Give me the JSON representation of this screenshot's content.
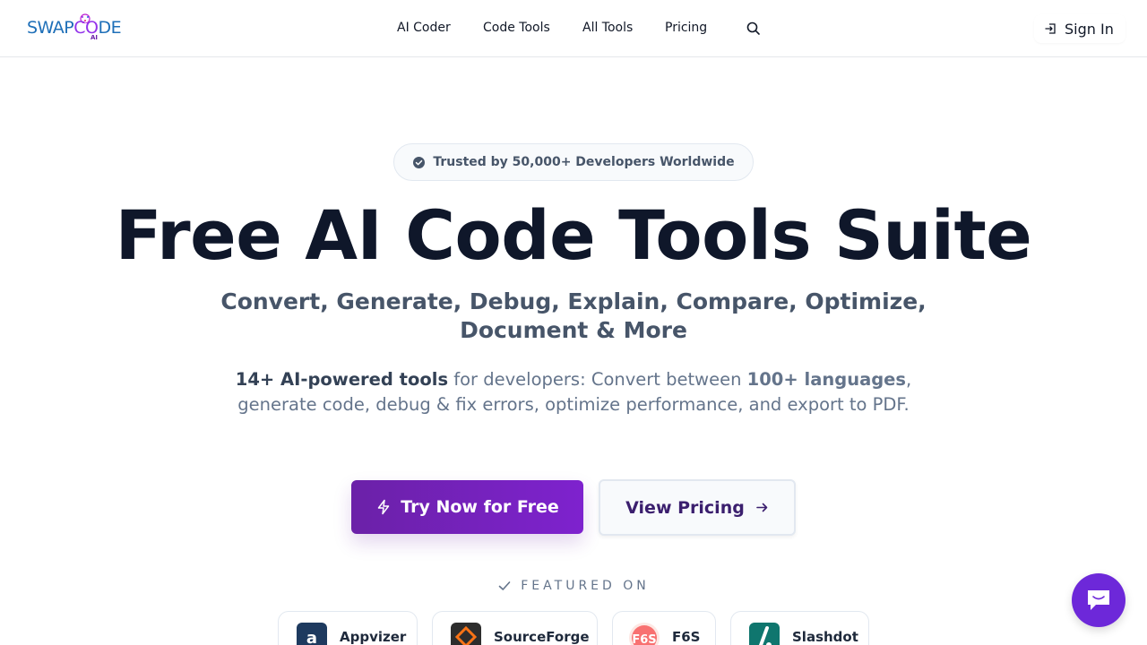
{
  "header": {
    "logo_text_a": "SWAP",
    "logo_text_b": "C",
    "logo_text_c": "DE",
    "logo_sub": "AI",
    "nav": [
      "AI Coder",
      "Code Tools",
      "All Tools",
      "Pricing"
    ],
    "search_icon": "search-icon",
    "signin_label": "Sign In"
  },
  "hero": {
    "badge": "Trusted by 50,000+ Developers Worldwide",
    "title": "Free AI Code Tools Suite",
    "subtitle": "Convert, Generate, Debug, Explain, Compare, Optimize, Document & More",
    "desc_part1": "14+ AI-powered tools",
    "desc_part2": " for developers: Convert between ",
    "desc_part3": "100+ languages",
    "desc_part4": ", generate code, debug & fix errors, optimize performance, and export to PDF.",
    "primary_button": "Try Now for Free",
    "secondary_button": "View Pricing"
  },
  "featured": {
    "label": "FEATURED ON",
    "partners": [
      "Appvizer",
      "SourceForge",
      "F6S",
      "Slashdot"
    ]
  },
  "colors": {
    "accent": "#6b21a8",
    "chat": "#6d28d9",
    "title": "#0f172a"
  }
}
